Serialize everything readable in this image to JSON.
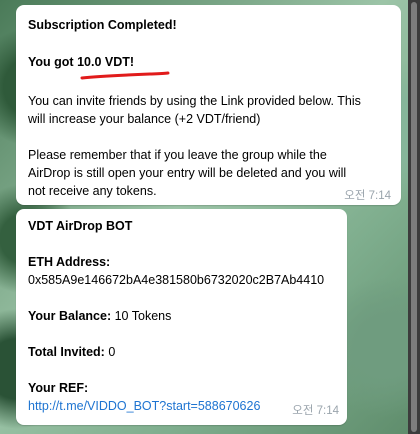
{
  "messages": [
    {
      "title": "Subscription Completed!",
      "got_prefix": "You got ",
      "got_amount": "10.0 VDT!",
      "invite_line1": "You can invite friends by using the Link provided below. This",
      "invite_line2": "will increase your balance (+2 VDT/friend)",
      "warn_line1": "Please remember that if you leave the group while the",
      "warn_line2": "AirDrop is still open your entry will be deleted and you will",
      "warn_line3": "not receive any tokens.",
      "time": "오전 7:14"
    },
    {
      "title": "VDT AirDrop BOT",
      "eth_label": "ETH Address:",
      "eth_value": "0x585A9e146672bA4e381580b6732020c2B7Ab4410",
      "balance_label": "Your Balance:",
      "balance_value": " 10 Tokens",
      "invited_label": "Total Invited:",
      "invited_value": " 0",
      "ref_label": "Your REF:",
      "ref_link": "http://t.me/VIDDO_BOT?start=588670626",
      "time": "오전 7:14"
    }
  ],
  "colors": {
    "link": "#1e74d1",
    "annotation": "#e11b1b"
  }
}
